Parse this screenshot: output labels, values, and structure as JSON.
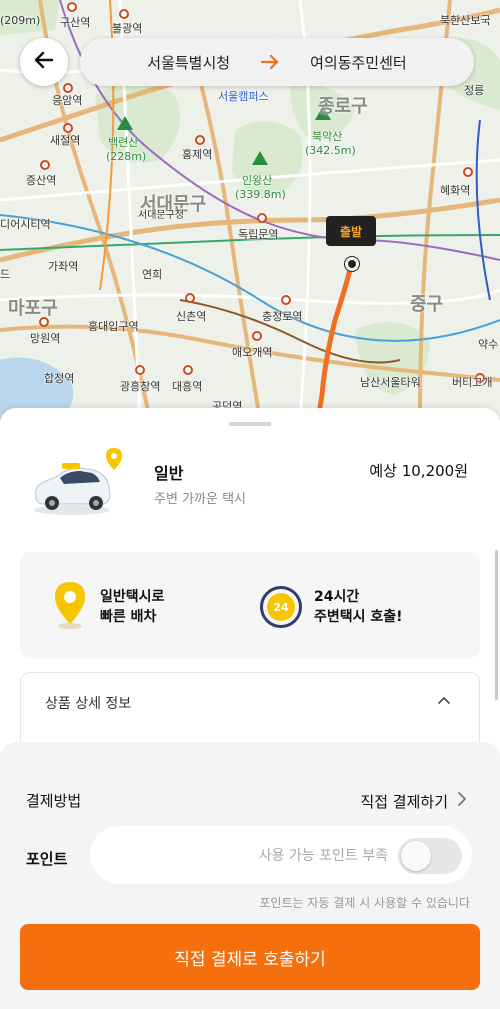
{
  "header": {
    "origin": "서울특별시청",
    "destination": "여의동주민센터"
  },
  "map": {
    "start_marker_label": "출발",
    "labels": {
      "guk_209": "(209m)",
      "gusan": "구산역",
      "bulgwang": "불광역",
      "bukhansan_bo": "북한산보국",
      "eungam": "응암역",
      "seoul_campus": "서울캠퍼스",
      "jongno_gu": "종로구",
      "jeongreung": "정릉",
      "saejeol": "새절역",
      "baengnyeonsan": "백련산",
      "baengnyeonsan_h": "(228m)",
      "hongje": "홍제역",
      "bugaksan": "북악산",
      "bugaksan_h": "(342.5m)",
      "jeungsan": "증산역",
      "inwangsan": "인왕산",
      "inwangsan_h": "(339.8m)",
      "hyehwa": "혜화역",
      "seodaemun_gu": "서대문구",
      "seodaemun_office": "서대문구청",
      "dmc": "디어시티역",
      "dongnimmun": "독립문역",
      "gajwa": "가좌역",
      "yeonhui": "연희",
      "mapo_gu": "마포구",
      "sinchon": "신촌역",
      "chungjeongno": "충정로역",
      "jung_gu": "중구",
      "mangwon": "망원역",
      "hongik": "홍대입구역",
      "aeogae": "애오개역",
      "yaksu": "약수",
      "hapjeong": "합정역",
      "gwangheungchang": "광흥창역",
      "daeheung": "대흥역",
      "namsan_tower": "남산서울타워",
      "beoti": "버티고개",
      "gongdeok": "공덕역",
      "edge_left": "드"
    }
  },
  "product": {
    "name": "일반",
    "description": "주변 가까운 택시",
    "price": "예상 10,200원"
  },
  "features": [
    {
      "line1": "일반택시로",
      "line2": "빠른 배차",
      "icon": "location-pin-icon"
    },
    {
      "line1": "24시간",
      "line2": "주변택시 호출!",
      "icon": "24h-icon",
      "badge": "24"
    }
  ],
  "detail": {
    "title": "상품 상세 정보"
  },
  "payment": {
    "method_label": "결제방법",
    "method_value": "직접 결제하기",
    "point_label": "포인트",
    "point_status": "사용 가능 포인트 부족",
    "point_note": "포인트는 자동 결제 시 사용할 수 있습니다",
    "toggle_on": false
  },
  "cta": {
    "label": "직접 결제로 호출하기"
  },
  "colors": {
    "accent": "#f5700c",
    "route_arrow": "#f07020",
    "marker_text": "#f5a623",
    "pin_yellow": "#f7c600",
    "badge_ring": "#2f3c6e"
  }
}
